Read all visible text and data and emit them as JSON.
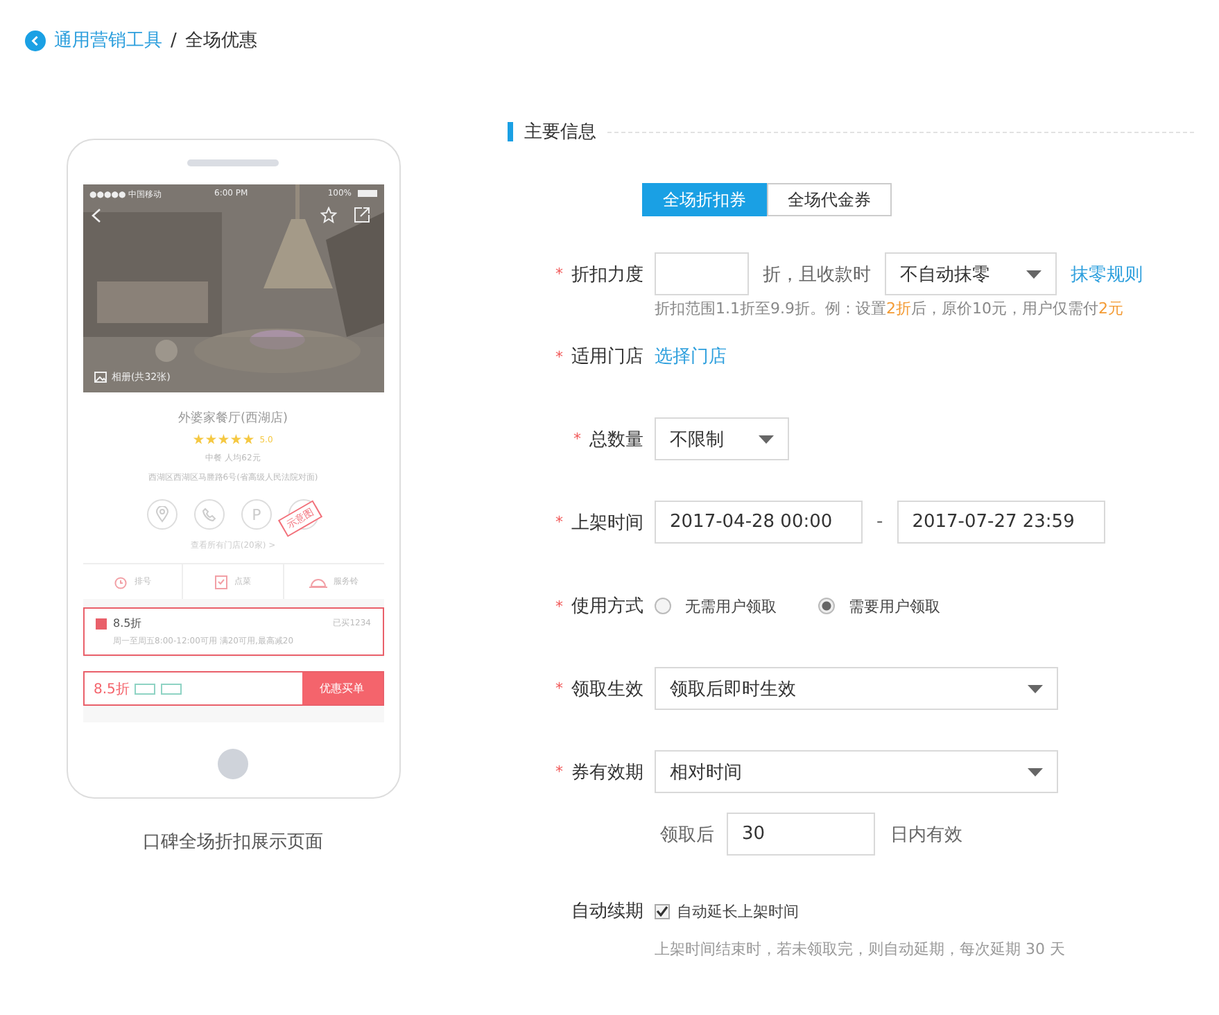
{
  "breadcrumb": {
    "parent": "通用营销工具",
    "separator": "/",
    "current": "全场优惠"
  },
  "preview": {
    "status_bar": {
      "carrier": "●●●●● 中国移动",
      "time": "6:00 PM",
      "battery": "100%"
    },
    "album": "相册(共32张)",
    "shop_name": "外婆家餐厅(西湖店)",
    "stars": 5,
    "rating": "5.0",
    "meta": "中餐  人均62元",
    "address": "西湖区西湖区马塍路6号(省高级人民法院对面)",
    "facilities": [
      {
        "kind": "location"
      },
      {
        "kind": "phone"
      },
      {
        "kind": "parking",
        "glyph": "P"
      },
      {
        "kind": "more"
      }
    ],
    "stamp": "示意图",
    "stores_link": "查看所有门店(20家) >",
    "tabs": [
      {
        "kind": "clock",
        "label": "排号"
      },
      {
        "kind": "order",
        "label": "点菜"
      },
      {
        "kind": "bell",
        "label": "服务铃"
      }
    ],
    "coupon": {
      "title": "8.5折",
      "sold": "已买1234",
      "detail": "周一至周五8:00-12:00可用    满20可用,最高减20"
    },
    "buy_bar": {
      "price": "8.5折",
      "button": "优惠买单"
    },
    "caption": "口碑全场折扣展示页面"
  },
  "form": {
    "section_title": "主要信息",
    "coupon_types": [
      {
        "label": "全场折扣券",
        "selected": true
      },
      {
        "label": "全场代金券",
        "selected": false
      }
    ],
    "discount": {
      "label": "折扣力度",
      "marker": "*",
      "unit": "折，且收款时",
      "rounding": "不自动抹零",
      "rule_link": "抹零规则",
      "hint": [
        {
          "text": "折扣范围1.1折至9.9折。例：设置",
          "highlight": false
        },
        {
          "text": "2折",
          "highlight": true
        },
        {
          "text": "后，原价10元，用户仅需付",
          "highlight": false
        },
        {
          "text": "2元",
          "highlight": true
        }
      ]
    },
    "stores": {
      "label": "适用门店",
      "marker": "*",
      "link": "选择门店"
    },
    "quantity": {
      "label": "总数量",
      "marker": "*",
      "value": "不限制"
    },
    "listing_time": {
      "label": "上架时间",
      "marker": "*",
      "start": "2017-04-28 00:00",
      "separator": "-",
      "end": "2017-07-27 23:59"
    },
    "usage": {
      "label": "使用方式",
      "marker": "*",
      "options": [
        {
          "label": "无需用户领取",
          "selected": false
        },
        {
          "label": "需要用户领取",
          "selected": true
        }
      ]
    },
    "effective": {
      "label": "领取生效",
      "marker": "*",
      "value": "领取后即时生效"
    },
    "validity": {
      "label": "券有效期",
      "marker": "*",
      "value": "相对时间",
      "prefix": "领取后",
      "days": "30",
      "suffix": "日内有效"
    },
    "renewal": {
      "label": "自动续期",
      "checkbox": {
        "label": "自动延长上架时间",
        "checked": true
      },
      "note": "上架时间结束时，若未领取完，则自动延期，每次延期 30 天"
    }
  }
}
